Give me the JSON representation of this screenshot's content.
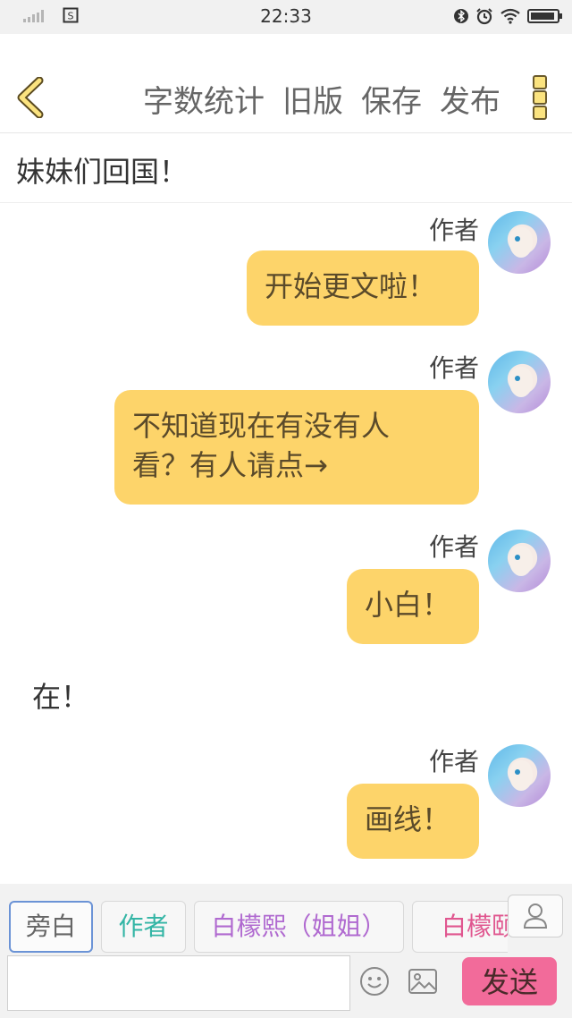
{
  "status_bar": {
    "time": "22:33",
    "sim_label": "S"
  },
  "toolbar": {
    "actions": [
      "字数统计",
      "旧版",
      "保存",
      "发布"
    ],
    "accent": "#fbe37f"
  },
  "chapter": {
    "title": "妹妹们回国！"
  },
  "messages": [
    {
      "speaker": "作者",
      "lines": [
        "开始更文啦！"
      ]
    },
    {
      "speaker": "作者",
      "lines": [
        "不知道现在有没有人",
        "看？有人请点→"
      ]
    },
    {
      "speaker": "作者",
      "lines": [
        "小白！"
      ]
    },
    {
      "narration": "在！"
    },
    {
      "speaker": "作者",
      "lines": [
        "画线！"
      ]
    }
  ],
  "roles": [
    {
      "label": "旁白",
      "color": "#666666",
      "active": true
    },
    {
      "label": "作者",
      "color": "#33b5a5",
      "active": false
    },
    {
      "label": "白檬熙（姐姐）",
      "color": "#b06ad0",
      "active": false
    },
    {
      "label": "白檬颐",
      "color": "#e0568f",
      "active": false
    }
  ],
  "input": {
    "value": "",
    "send_label": "发送"
  },
  "colors": {
    "bubble": "#fdd46a",
    "send": "#f26b9a"
  }
}
